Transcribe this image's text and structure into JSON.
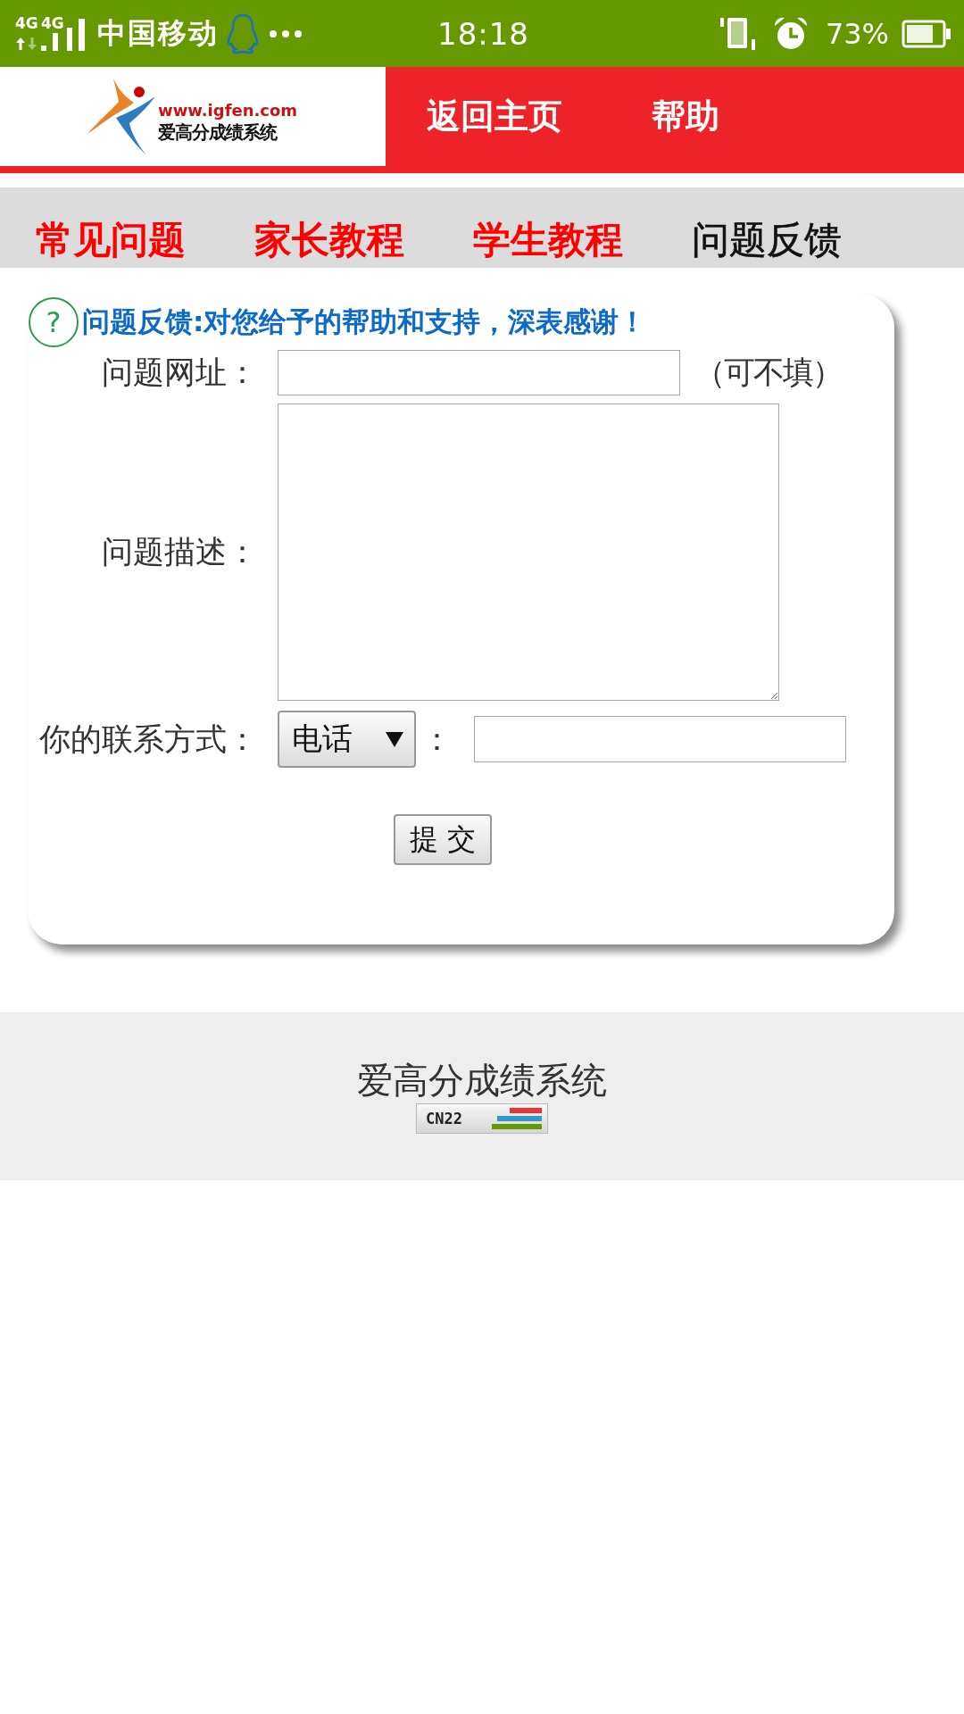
{
  "status_bar": {
    "network_1": "4G",
    "network_2": "4G",
    "carrier": "中国移动",
    "time": "18:18",
    "battery": "73%"
  },
  "header": {
    "logo_url": "www.igfen.com",
    "logo_name": "爱高分成绩系统",
    "nav": [
      "返回主页",
      "帮助"
    ]
  },
  "tabs": [
    {
      "label": "常见问题",
      "selected": false
    },
    {
      "label": "家长教程",
      "selected": false
    },
    {
      "label": "学生教程",
      "selected": false
    },
    {
      "label": "问题反馈",
      "selected": true
    }
  ],
  "feedback_form": {
    "help_icon": "?",
    "title": "问题反馈:对您给予的帮助和支持，深表感谢！",
    "url_label": "问题网址：",
    "url_note": "（可不填）",
    "description_label": "问题描述：",
    "contact_label": "你的联系方式：",
    "contact_type": "电话",
    "contact_separator": "：",
    "submit": "提 交"
  },
  "footer": {
    "title": "爱高分成绩系统",
    "counter_badge": "CN22"
  }
}
